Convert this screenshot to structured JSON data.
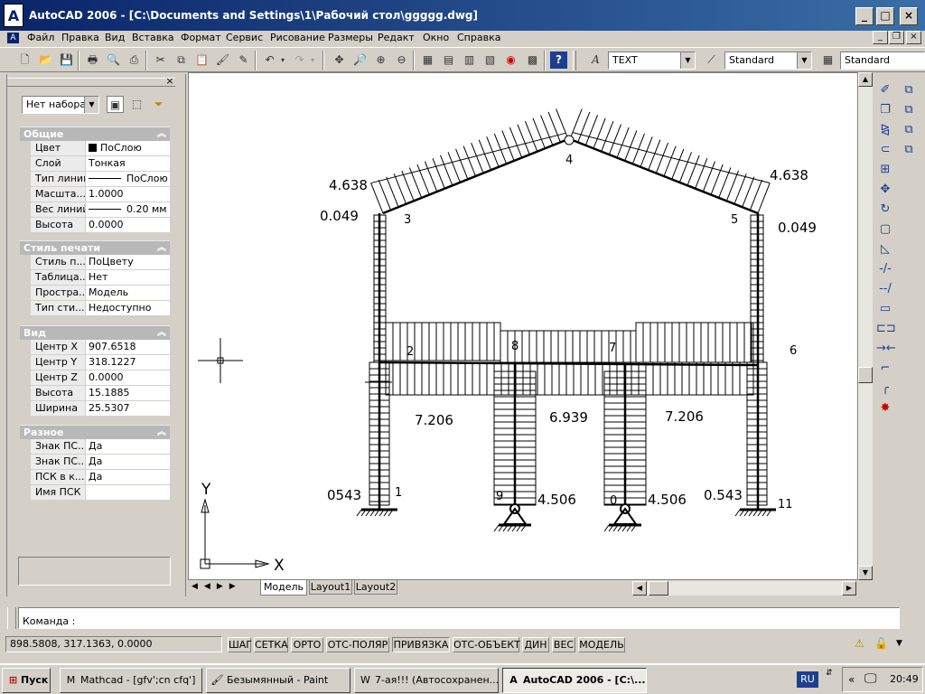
{
  "window": {
    "title": "AutoCAD 2006 - [C:\\Documents and Settings\\1\\Рабочий стол\\ggggg.dwg]",
    "controls": {
      "minimize": "_",
      "maximize": "□",
      "close": "×"
    }
  },
  "menu": [
    "Файл",
    "Правка",
    "Вид",
    "Вставка",
    "Формат",
    "Сервис",
    "Рисование",
    "Размеры",
    "Редакт",
    "Окно",
    "Справка"
  ],
  "toolbar": {
    "text_style": "TEXT",
    "dim_style": "Standard",
    "table_style": "Standard"
  },
  "properties": {
    "selection": "Нет набора",
    "sections": [
      {
        "title": "Общие",
        "rows": [
          {
            "k": "Цвет",
            "v": "ПоСлою",
            "swatch": "#000000"
          },
          {
            "k": "Слой",
            "v": "Тонкая"
          },
          {
            "k": "Тип линий",
            "v": "ПоСлою",
            "line": true
          },
          {
            "k": "Масшта...",
            "v": "1.0000"
          },
          {
            "k": "Вес линий",
            "v": "0.20 мм",
            "line": true
          },
          {
            "k": "Высота",
            "v": "0.0000"
          }
        ]
      },
      {
        "title": "Стиль печати",
        "rows": [
          {
            "k": "Стиль п...",
            "v": "ПоЦвету"
          },
          {
            "k": "Таблица...",
            "v": "Нет"
          },
          {
            "k": "Простра...",
            "v": "Модель"
          },
          {
            "k": "Тип сти...",
            "v": "Недоступно"
          }
        ]
      },
      {
        "title": "Вид",
        "rows": [
          {
            "k": "Центр X",
            "v": "907.6518"
          },
          {
            "k": "Центр Y",
            "v": "318.1227"
          },
          {
            "k": "Центр Z",
            "v": "0.0000"
          },
          {
            "k": "Высота",
            "v": "15.1885"
          },
          {
            "k": "Ширина",
            "v": "25.5307"
          }
        ]
      },
      {
        "title": "Разное",
        "rows": [
          {
            "k": "Знак ПС...",
            "v": "Да"
          },
          {
            "k": "Знак ПС...",
            "v": "Да"
          },
          {
            "k": "ПСК в к...",
            "v": "Да"
          },
          {
            "k": "Имя ПСК",
            "v": ""
          }
        ]
      }
    ]
  },
  "drawing": {
    "values": [
      "4.638",
      "4.638",
      "0.049",
      "0.049",
      "7.206",
      "6.939",
      "7.206",
      "0543",
      "4.506",
      "4.506",
      "0.543"
    ],
    "nodes": [
      "1",
      "2",
      "3",
      "4",
      "5",
      "6",
      "7",
      "8",
      "9",
      "0",
      "11"
    ],
    "axis": {
      "x": "X",
      "y": "Y"
    }
  },
  "tabs": [
    "Модель",
    "Layout1",
    "Layout2"
  ],
  "command": {
    "prompt": "Команда :",
    "value": ""
  },
  "status": {
    "coords": "898.5808, 317.1363, 0.0000",
    "buttons": [
      "ШАГ",
      "СЕТКА",
      "ОРТО",
      "ОТС-ПОЛЯР",
      "ПРИВЯЗКА",
      "ОТС-ОБЪЕКТ",
      "ДИН",
      "ВЕС",
      "МОДЕЛЬ"
    ]
  },
  "taskbar": {
    "start": "Пуск",
    "tasks": [
      "Mathcad - [gfv';cn cfq']",
      "Безымянный - Paint",
      "7-ая!!! (Автосохранен...",
      "AutoCAD 2006 - [C:\\..."
    ],
    "lang": "RU",
    "clock": "20:49"
  }
}
